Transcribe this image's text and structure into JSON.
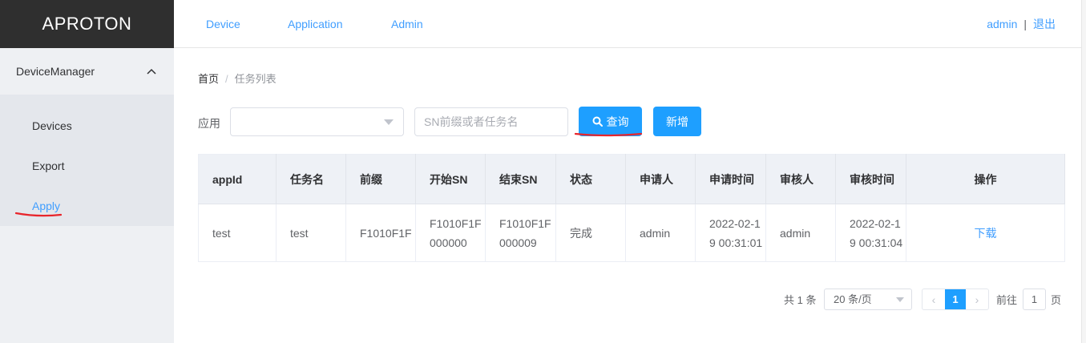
{
  "app": {
    "logo": "APROTON"
  },
  "header": {
    "nav": [
      "Device",
      "Application",
      "Admin"
    ],
    "user": "admin",
    "separator": "|",
    "logout": "退出"
  },
  "sidebar": {
    "group": "DeviceManager",
    "items": [
      "Devices",
      "Export",
      "Apply"
    ],
    "active": "Apply"
  },
  "breadcrumb": {
    "home": "首页",
    "separator": "/",
    "current": "任务列表"
  },
  "filter": {
    "app_label": "应用",
    "app_value": "",
    "search_placeholder": "SN前缀或者任务名",
    "query_button": "查询",
    "add_button": "新增"
  },
  "table": {
    "columns": [
      "appId",
      "任务名",
      "前缀",
      "开始SN",
      "结束SN",
      "状态",
      "申请人",
      "申请时间",
      "审核人",
      "审核时间",
      "操作"
    ],
    "rows": [
      {
        "appId": "test",
        "task_name": "test",
        "prefix": "F1010F1F",
        "start_sn": "F1010F1F000000",
        "end_sn": "F1010F1F000009",
        "status": "完成",
        "applicant": "admin",
        "apply_time": "2022-02-19 00:31:01",
        "reviewer": "admin",
        "review_time": "2022-02-19 00:31:04",
        "action": "下载"
      }
    ]
  },
  "pagination": {
    "total_text": "共 1 条",
    "page_size": "20 条/页",
    "current_page": "1",
    "goto_prefix": "前往",
    "goto_value": "1",
    "goto_suffix": "页"
  },
  "colors": {
    "primary": "#1e9fff",
    "link": "#409eff",
    "logo_bg": "#2f2f2f",
    "annotation": "#e8252b"
  }
}
